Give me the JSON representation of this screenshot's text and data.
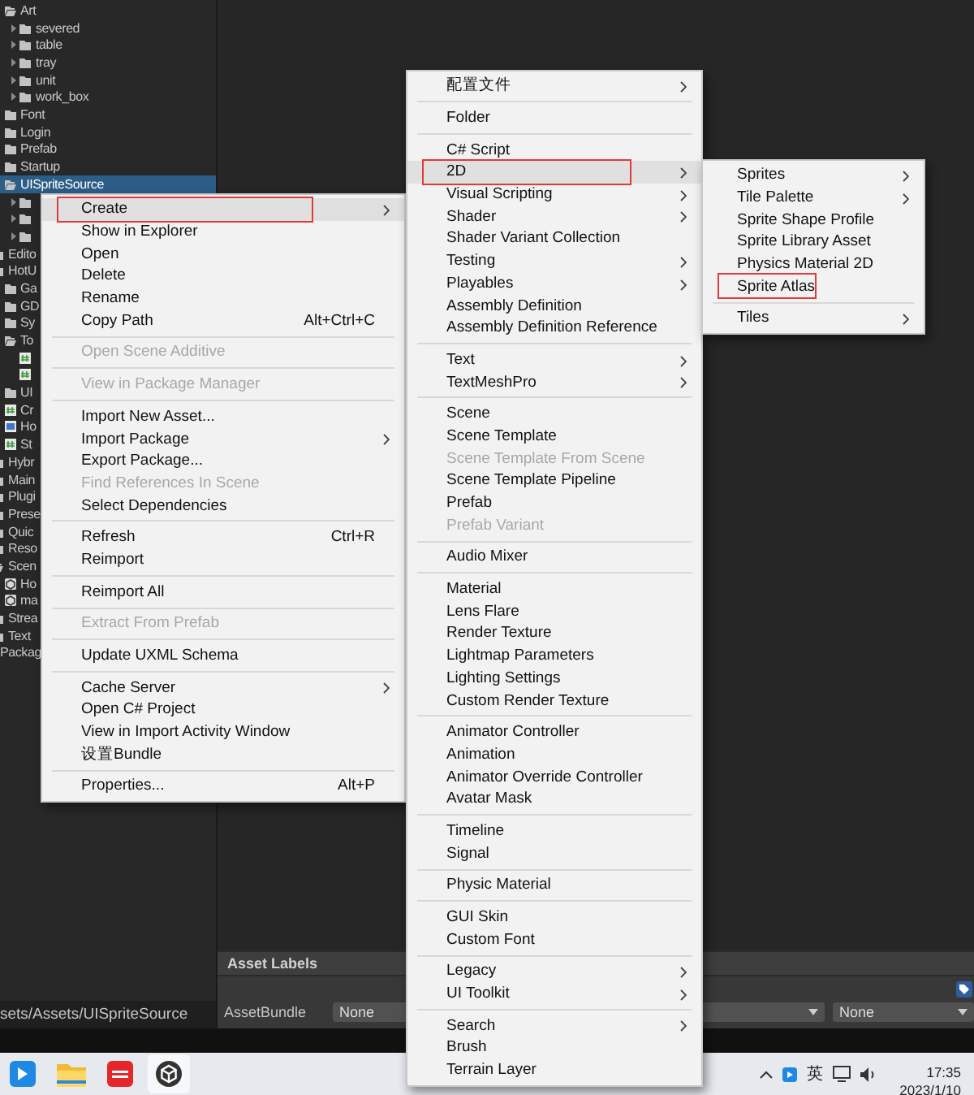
{
  "project_tree": {
    "items": [
      {
        "kind": "folder-open",
        "children": [
          {
            "kind": "folder-open",
            "label": "Art",
            "selected": false,
            "children": [
              {
                "kind": "folder",
                "label": "severed",
                "selected": false,
                "expanded": false
              },
              {
                "kind": "folder",
                "label": "table",
                "selected": false,
                "expanded": false
              },
              {
                "kind": "folder",
                "label": "tray",
                "selected": false,
                "expanded": false
              },
              {
                "kind": "folder",
                "label": "unit",
                "selected": false,
                "expanded": false
              },
              {
                "kind": "folder",
                "label": "work_box",
                "selected": false,
                "expanded": false
              }
            ]
          },
          {
            "kind": "folder",
            "label": "Font",
            "selected": false
          },
          {
            "kind": "folder",
            "label": "Login",
            "selected": false
          },
          {
            "kind": "folder",
            "label": "Prefab",
            "selected": false
          },
          {
            "kind": "folder",
            "label": "Startup",
            "selected": false
          },
          {
            "kind": "folder-open",
            "label": "UISpriteSource",
            "selected": true,
            "children": [
              {
                "kind": "folder",
                "selected": false,
                "expanded": false
              },
              {
                "kind": "folder",
                "selected": false,
                "expanded": false
              },
              {
                "kind": "folder",
                "selected": false,
                "expanded": false
              }
            ]
          }
        ]
      },
      {
        "kind": "folder",
        "label": "Edito",
        "selected": false
      },
      {
        "kind": "folder",
        "label": "HotU",
        "selected": false,
        "children": [
          {
            "kind": "folder",
            "label": "Ga",
            "selected": false
          },
          {
            "kind": "folder",
            "label": "GD",
            "selected": false
          },
          {
            "kind": "folder",
            "label": "Sy",
            "selected": false
          },
          {
            "kind": "folder-open",
            "label": "To",
            "selected": false,
            "children": [
              {
                "kind": "script",
                "selected": false
              },
              {
                "kind": "script",
                "selected": false
              }
            ]
          },
          {
            "kind": "folder",
            "label": "UI",
            "selected": false
          },
          {
            "kind": "script",
            "label": "Cr",
            "selected": false
          },
          {
            "kind": "asset",
            "label": "Ho",
            "selected": false
          },
          {
            "kind": "script",
            "label": "St",
            "selected": false
          }
        ]
      },
      {
        "kind": "folder",
        "label": "Hybr",
        "selected": false
      },
      {
        "kind": "folder",
        "label": "Main",
        "selected": false
      },
      {
        "kind": "folder",
        "label": "Plugi",
        "selected": false
      },
      {
        "kind": "folder",
        "label": "Prese",
        "selected": false
      },
      {
        "kind": "folder",
        "label": "Quic",
        "selected": false
      },
      {
        "kind": "folder",
        "label": "Reso",
        "selected": false
      },
      {
        "kind": "folder-open",
        "label": "Scen",
        "selected": false,
        "children": [
          {
            "kind": "scene",
            "label": "Ho",
            "selected": false
          },
          {
            "kind": "scene",
            "label": "ma",
            "selected": false
          }
        ]
      },
      {
        "kind": "folder",
        "label": "Strea",
        "selected": false
      },
      {
        "kind": "folder",
        "label": "Text",
        "selected": false
      },
      {
        "kind": "root",
        "label": "Packag",
        "selected": false
      }
    ]
  },
  "path_bar": {
    "text": "sets/Assets/UISpriteSource"
  },
  "inspector": {
    "header": "Asset Labels",
    "label": "AssetBundle",
    "bundle": "None",
    "variant": "None"
  },
  "context_menu": {
    "groups": [
      [
        {
          "label": "Create",
          "submenu": true,
          "selected": true,
          "disabled": false,
          "marked": true
        },
        {
          "label": "Show in Explorer",
          "submenu": false,
          "selected": false,
          "disabled": false,
          "marked": false
        },
        {
          "label": "Open",
          "submenu": false,
          "selected": false,
          "disabled": false,
          "marked": false
        },
        {
          "label": "Delete",
          "submenu": false,
          "selected": false,
          "disabled": false,
          "marked": false
        },
        {
          "label": "Rename",
          "submenu": false,
          "selected": false,
          "disabled": false,
          "marked": false
        },
        {
          "label": "Copy Path",
          "shortcut": "Alt+Ctrl+C",
          "submenu": false,
          "selected": false,
          "disabled": false,
          "marked": false
        }
      ],
      [
        {
          "label": "Open Scene Additive",
          "submenu": false,
          "selected": false,
          "disabled": true,
          "marked": false
        }
      ],
      [
        {
          "label": "View in Package Manager",
          "submenu": false,
          "selected": false,
          "disabled": true,
          "marked": false
        }
      ],
      [
        {
          "label": "Import New Asset...",
          "submenu": false,
          "selected": false,
          "disabled": false,
          "marked": false
        },
        {
          "label": "Import Package",
          "submenu": true,
          "selected": false,
          "disabled": false,
          "marked": false
        },
        {
          "label": "Export Package...",
          "submenu": false,
          "selected": false,
          "disabled": false,
          "marked": false
        },
        {
          "label": "Find References In Scene",
          "submenu": false,
          "selected": false,
          "disabled": true,
          "marked": false
        },
        {
          "label": "Select Dependencies",
          "submenu": false,
          "selected": false,
          "disabled": false,
          "marked": false
        }
      ],
      [
        {
          "label": "Refresh",
          "shortcut": "Ctrl+R",
          "submenu": false,
          "selected": false,
          "disabled": false,
          "marked": false
        },
        {
          "label": "Reimport",
          "submenu": false,
          "selected": false,
          "disabled": false,
          "marked": false
        }
      ],
      [
        {
          "label": "Reimport All",
          "submenu": false,
          "selected": false,
          "disabled": false,
          "marked": false
        }
      ],
      [
        {
          "label": "Extract From Prefab",
          "submenu": false,
          "selected": false,
          "disabled": true,
          "marked": false
        }
      ],
      [
        {
          "label": "Update UXML Schema",
          "submenu": false,
          "selected": false,
          "disabled": false,
          "marked": false
        }
      ],
      [
        {
          "label": "Cache Server",
          "submenu": true,
          "selected": false,
          "disabled": false,
          "marked": false
        },
        {
          "label": "Open C# Project",
          "submenu": false,
          "selected": false,
          "disabled": false,
          "marked": false
        },
        {
          "label": "View in Import Activity Window",
          "submenu": false,
          "selected": false,
          "disabled": false,
          "marked": false
        },
        {
          "label": "设置Bundle",
          "submenu": false,
          "selected": false,
          "disabled": false,
          "marked": false
        }
      ],
      [
        {
          "label": "Properties...",
          "shortcut": "Alt+P",
          "submenu": false,
          "selected": false,
          "disabled": false,
          "marked": false
        }
      ]
    ]
  },
  "create_menu": {
    "groups": [
      [
        {
          "label": "配置文件",
          "submenu": true,
          "selected": false,
          "disabled": false,
          "marked": false
        }
      ],
      [
        {
          "label": "Folder",
          "submenu": false,
          "selected": false,
          "disabled": false,
          "marked": false
        }
      ],
      [
        {
          "label": "C# Script",
          "submenu": false,
          "selected": false,
          "disabled": false,
          "marked": false
        },
        {
          "label": "2D",
          "submenu": true,
          "selected": true,
          "disabled": false,
          "marked": true
        },
        {
          "label": "Visual Scripting",
          "submenu": true,
          "selected": false,
          "disabled": false,
          "marked": false
        },
        {
          "label": "Shader",
          "submenu": true,
          "selected": false,
          "disabled": false,
          "marked": false
        },
        {
          "label": "Shader Variant Collection",
          "submenu": false,
          "selected": false,
          "disabled": false,
          "marked": false
        },
        {
          "label": "Testing",
          "submenu": true,
          "selected": false,
          "disabled": false,
          "marked": false
        },
        {
          "label": "Playables",
          "submenu": true,
          "selected": false,
          "disabled": false,
          "marked": false
        },
        {
          "label": "Assembly Definition",
          "submenu": false,
          "selected": false,
          "disabled": false,
          "marked": false
        },
        {
          "label": "Assembly Definition Reference",
          "submenu": false,
          "selected": false,
          "disabled": false,
          "marked": false
        }
      ],
      [
        {
          "label": "Text",
          "submenu": true,
          "selected": false,
          "disabled": false,
          "marked": false
        },
        {
          "label": "TextMeshPro",
          "submenu": true,
          "selected": false,
          "disabled": false,
          "marked": false
        }
      ],
      [
        {
          "label": "Scene",
          "submenu": false,
          "selected": false,
          "disabled": false,
          "marked": false
        },
        {
          "label": "Scene Template",
          "submenu": false,
          "selected": false,
          "disabled": false,
          "marked": false
        },
        {
          "label": "Scene Template From Scene",
          "submenu": false,
          "selected": false,
          "disabled": true,
          "marked": false
        },
        {
          "label": "Scene Template Pipeline",
          "submenu": false,
          "selected": false,
          "disabled": false,
          "marked": false
        },
        {
          "label": "Prefab",
          "submenu": false,
          "selected": false,
          "disabled": false,
          "marked": false
        },
        {
          "label": "Prefab Variant",
          "submenu": false,
          "selected": false,
          "disabled": true,
          "marked": false
        }
      ],
      [
        {
          "label": "Audio Mixer",
          "submenu": false,
          "selected": false,
          "disabled": false,
          "marked": false
        }
      ],
      [
        {
          "label": "Material",
          "submenu": false,
          "selected": false,
          "disabled": false,
          "marked": false
        },
        {
          "label": "Lens Flare",
          "submenu": false,
          "selected": false,
          "disabled": false,
          "marked": false
        },
        {
          "label": "Render Texture",
          "submenu": false,
          "selected": false,
          "disabled": false,
          "marked": false
        },
        {
          "label": "Lightmap Parameters",
          "submenu": false,
          "selected": false,
          "disabled": false,
          "marked": false
        },
        {
          "label": "Lighting Settings",
          "submenu": false,
          "selected": false,
          "disabled": false,
          "marked": false
        },
        {
          "label": "Custom Render Texture",
          "submenu": false,
          "selected": false,
          "disabled": false,
          "marked": false
        }
      ],
      [
        {
          "label": "Animator Controller",
          "submenu": false,
          "selected": false,
          "disabled": false,
          "marked": false
        },
        {
          "label": "Animation",
          "submenu": false,
          "selected": false,
          "disabled": false,
          "marked": false
        },
        {
          "label": "Animator Override Controller",
          "submenu": false,
          "selected": false,
          "disabled": false,
          "marked": false
        },
        {
          "label": "Avatar Mask",
          "submenu": false,
          "selected": false,
          "disabled": false,
          "marked": false
        }
      ],
      [
        {
          "label": "Timeline",
          "submenu": false,
          "selected": false,
          "disabled": false,
          "marked": false
        },
        {
          "label": "Signal",
          "submenu": false,
          "selected": false,
          "disabled": false,
          "marked": false
        }
      ],
      [
        {
          "label": "Physic Material",
          "submenu": false,
          "selected": false,
          "disabled": false,
          "marked": false
        }
      ],
      [
        {
          "label": "GUI Skin",
          "submenu": false,
          "selected": false,
          "disabled": false,
          "marked": false
        },
        {
          "label": "Custom Font",
          "submenu": false,
          "selected": false,
          "disabled": false,
          "marked": false
        }
      ],
      [
        {
          "label": "Legacy",
          "submenu": true,
          "selected": false,
          "disabled": false,
          "marked": false
        },
        {
          "label": "UI Toolkit",
          "submenu": true,
          "selected": false,
          "disabled": false,
          "marked": false
        }
      ],
      [
        {
          "label": "Search",
          "submenu": true,
          "selected": false,
          "disabled": false,
          "marked": false
        },
        {
          "label": "Brush",
          "submenu": false,
          "selected": false,
          "disabled": false,
          "marked": false
        },
        {
          "label": "Terrain Layer",
          "submenu": false,
          "selected": false,
          "disabled": false,
          "marked": false
        }
      ]
    ]
  },
  "menu_2d": {
    "groups": [
      [
        {
          "label": "Sprites",
          "submenu": true,
          "selected": false,
          "disabled": false,
          "marked": false
        },
        {
          "label": "Tile Palette",
          "submenu": true,
          "selected": false,
          "disabled": false,
          "marked": false
        },
        {
          "label": "Sprite Shape Profile",
          "submenu": false,
          "selected": false,
          "disabled": false,
          "marked": false
        },
        {
          "label": "Sprite Library Asset",
          "submenu": false,
          "selected": false,
          "disabled": false,
          "marked": false
        },
        {
          "label": "Physics Material 2D",
          "submenu": false,
          "selected": false,
          "disabled": false,
          "marked": false
        },
        {
          "label": "Sprite Atlas",
          "submenu": false,
          "selected": false,
          "disabled": false,
          "marked": true
        }
      ],
      [
        {
          "label": "Tiles",
          "submenu": true,
          "selected": false,
          "disabled": false,
          "marked": false
        }
      ]
    ]
  },
  "taskbar": {
    "apps": [
      {
        "kind": "messenger",
        "selected": false
      },
      {
        "kind": "folder",
        "selected": false
      },
      {
        "kind": "dictionary",
        "selected": false
      },
      {
        "kind": "unity",
        "selected": true
      }
    ],
    "ime": "英",
    "time": "17:35",
    "date": "2023/1/10"
  }
}
